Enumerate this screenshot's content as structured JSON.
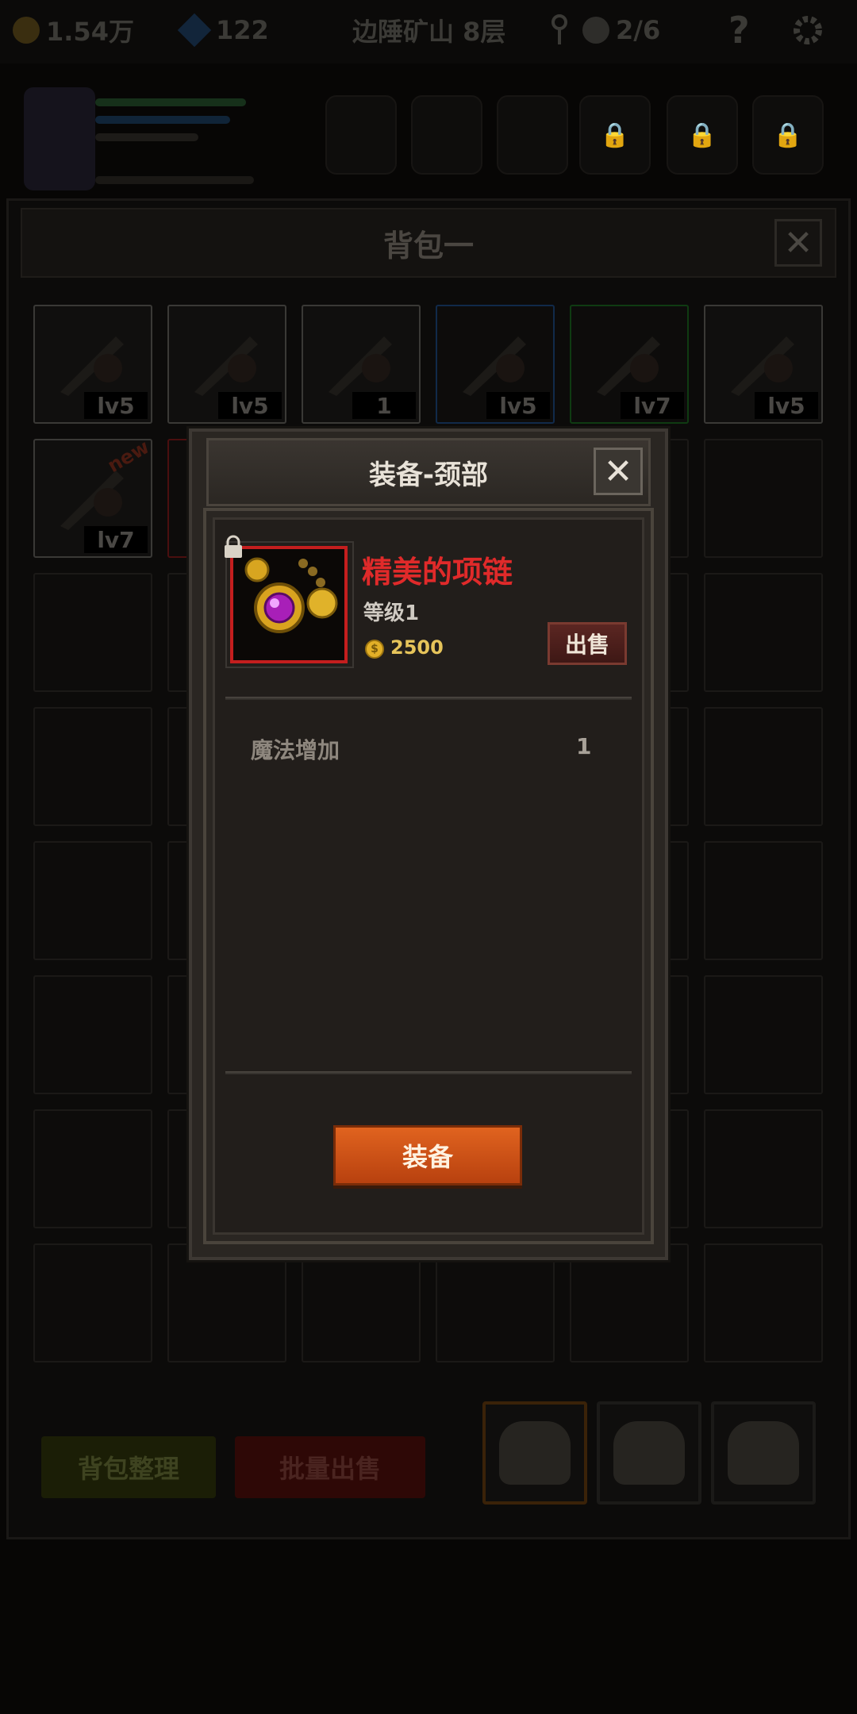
{
  "top_bar": {
    "gold": "1.54万",
    "gems": "122",
    "location": "边陲矿山 8层",
    "skull_progress": "2/6",
    "help_symbol": "?"
  },
  "backpack": {
    "title": "背包一",
    "close_symbol": "✕",
    "items": [
      {
        "label": "lv5",
        "rarity": "gray"
      },
      {
        "label": "lv5",
        "rarity": "gray"
      },
      {
        "label": "1",
        "rarity": "gray"
      },
      {
        "label": "lv5",
        "rarity": "blue"
      },
      {
        "label": "lv7",
        "rarity": "green"
      },
      {
        "label": "lv5",
        "rarity": "gray"
      },
      {
        "label": "lv7",
        "rarity": "gray",
        "badge": "new"
      }
    ],
    "sort_button": "背包整理",
    "bulk_sell_button": "批量出售"
  },
  "modal": {
    "title": "装备-颈部",
    "close_symbol": "✕",
    "item": {
      "name": "精美的项链",
      "level": "等级1",
      "price": "2500",
      "coin_symbol": "$",
      "sell_button": "出售"
    },
    "attributes": [
      {
        "name": "魔法增加",
        "value": "1"
      }
    ],
    "equip_button": "装备"
  },
  "colors": {
    "item_name": "#e02a2a",
    "item_border": "#c41e1e",
    "equip_button": "#d0561a",
    "sell_button": "#5b2622"
  }
}
